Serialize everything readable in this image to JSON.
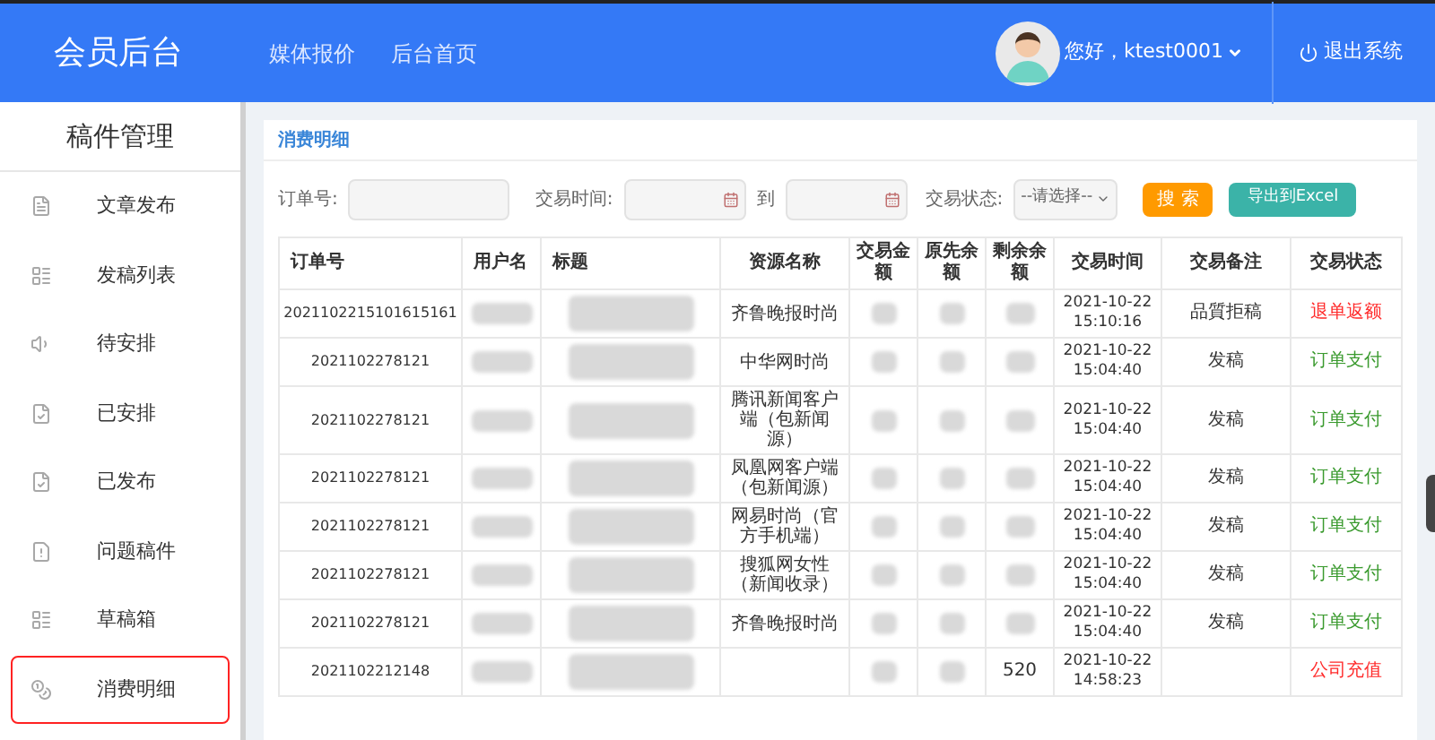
{
  "header": {
    "title": "会员后台",
    "nav": [
      {
        "label": "媒体报价"
      },
      {
        "label": "后台首页"
      }
    ],
    "greeting": "您好，ktest0001",
    "logout": "退出系统"
  },
  "sidebar": {
    "title": "稿件管理",
    "items": [
      {
        "label": "文章发布",
        "kind": "file",
        "selected": false
      },
      {
        "label": "发稿列表",
        "kind": "list",
        "selected": false
      },
      {
        "label": "待安排",
        "kind": "speaker",
        "selected": false
      },
      {
        "label": "已安排",
        "kind": "filecheck",
        "selected": false
      },
      {
        "label": "已发布",
        "kind": "filecheck",
        "selected": false
      },
      {
        "label": "问题稿件",
        "kind": "filewarn",
        "selected": false
      },
      {
        "label": "草稿箱",
        "kind": "list",
        "selected": false
      },
      {
        "label": "消费明细",
        "kind": "coins",
        "selected": true
      }
    ]
  },
  "panel": {
    "title": "消费明细"
  },
  "filters": {
    "order_label": "订单号:",
    "time_label": "交易时间:",
    "to_label": "到",
    "status_label": "交易状态:",
    "status_value": "--请选择--",
    "search_button": "搜 索",
    "export_button": "导出到Excel"
  },
  "table": {
    "columns": [
      "订单号",
      "用户名",
      "标题",
      "资源名称",
      "交易金额",
      "原先余额",
      "剩余余额",
      "交易时间",
      "交易备注",
      "交易状态"
    ],
    "rows": [
      {
        "order": "2021102215101615161",
        "resource": "齐鲁晚报时尚",
        "time": [
          "2021-10-22",
          "15:10:16"
        ],
        "remark": "品質拒稿",
        "status": "退单返额",
        "color": "#ff2a2a"
      },
      {
        "order": "2021102278121",
        "resource": "中华网时尚",
        "time": [
          "2021-10-22",
          "15:04:40"
        ],
        "remark": "发稿",
        "status": "订单支付",
        "color": "#3a9a2e"
      },
      {
        "order": "2021102278121",
        "resource": "腾讯新闻客户端（包新闻源）",
        "time": [
          "2021-10-22",
          "15:04:40"
        ],
        "remark": "发稿",
        "status": "订单支付",
        "color": "#3a9a2e"
      },
      {
        "order": "2021102278121",
        "resource": "凤凰网客户端（包新闻源）",
        "time": [
          "2021-10-22",
          "15:04:40"
        ],
        "remark": "发稿",
        "status": "订单支付",
        "color": "#3a9a2e"
      },
      {
        "order": "2021102278121",
        "resource": "网易时尚（官方手机端）",
        "time": [
          "2021-10-22",
          "15:04:40"
        ],
        "remark": "发稿",
        "status": "订单支付",
        "color": "#3a9a2e"
      },
      {
        "order": "2021102278121",
        "resource": "搜狐网女性（新闻收录）",
        "time": [
          "2021-10-22",
          "15:04:40"
        ],
        "remark": "发稿",
        "status": "订单支付",
        "color": "#3a9a2e"
      },
      {
        "order": "2021102278121",
        "resource": "齐鲁晚报时尚",
        "time": [
          "2021-10-22",
          "15:04:40"
        ],
        "remark": "发稿",
        "status": "订单支付",
        "color": "#3a9a2e"
      },
      {
        "order": "2021102212148",
        "remaining": "520",
        "time": [
          "2021-10-22",
          "14:58:23"
        ],
        "status": "公司充值",
        "color": "#ff2a2a"
      }
    ]
  }
}
